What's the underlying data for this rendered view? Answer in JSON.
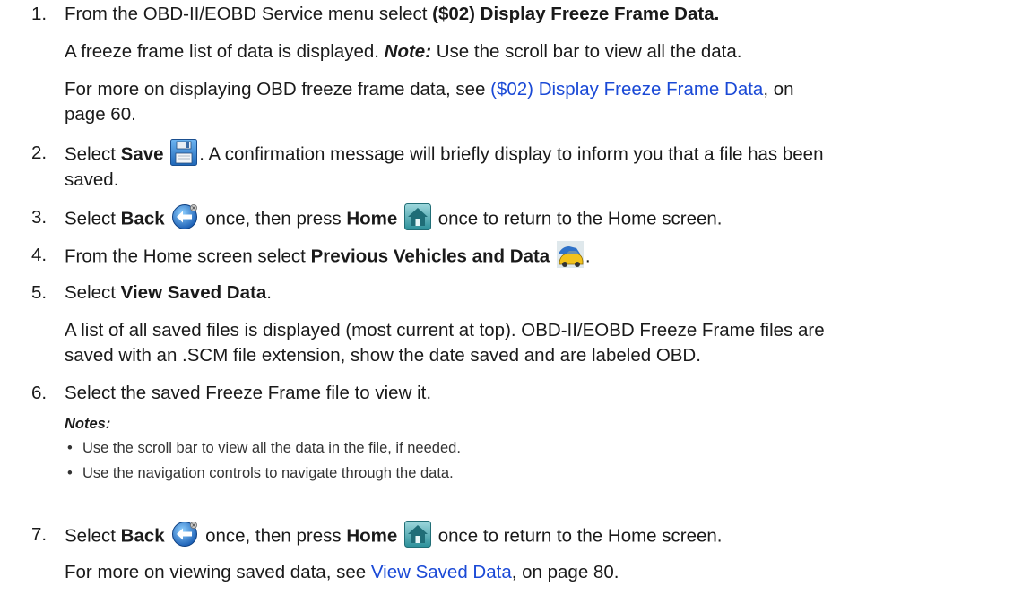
{
  "steps": {
    "s1": {
      "num": "1.",
      "pre": "From the OBD-II/EOBD Service menu select ",
      "bold": "($02) Display Freeze Frame Data.",
      "line2_pre": "A freeze frame list of data is displayed. ",
      "line2_note": "Note:",
      "line2_post": " Use the scroll bar to view all the data.",
      "line3_pre": "For more on displaying OBD freeze frame data, see ",
      "line3_link": "($02) Display Freeze Frame Data",
      "line3_post": ", on",
      "line4": "page 60."
    },
    "s2": {
      "num": "2.",
      "pre": "Select ",
      "bold": "Save",
      "post": ". A confirmation message will briefly display to inform you that a file has been",
      "line2": "saved."
    },
    "s3": {
      "num": "3.",
      "pre": "Select ",
      "bold1": "Back",
      "mid": " once, then press ",
      "bold2": "Home",
      "post": " once to return to the Home screen."
    },
    "s4": {
      "num": "4.",
      "pre": "From the Home screen select ",
      "bold": "Previous Vehicles and Data",
      "post": "."
    },
    "s5": {
      "num": "5.",
      "pre": "Select ",
      "bold": "View Saved Data",
      "post": ".",
      "line2": "A list of all saved files is displayed (most current at top). OBD-II/EOBD Freeze Frame files are",
      "line3": "saved with an .SCM file extension, show the date saved and are labeled OBD."
    },
    "s6": {
      "num": "6.",
      "text": "Select the saved Freeze Frame file to view it.",
      "notes_label": "Notes:",
      "bullet": "•",
      "notes": [
        "Use the scroll bar to view all the data in the file, if needed.",
        "Use the navigation controls to navigate through the data."
      ]
    },
    "s7": {
      "num": "7.",
      "pre": "Select ",
      "bold1": "Back",
      "mid": " once, then press ",
      "bold2": "Home",
      "post": " once to return to the Home screen.",
      "line2_pre": "For more on viewing saved data, see ",
      "line2_link": "View Saved Data",
      "line2_post": ", on page 80."
    }
  },
  "icons": {
    "save": "save-icon",
    "back": "back-arrow-icon",
    "home": "home-icon",
    "vehicles": "previous-vehicles-icon"
  },
  "colors": {
    "link": "#1a49d6",
    "text": "#1a1a1a"
  }
}
